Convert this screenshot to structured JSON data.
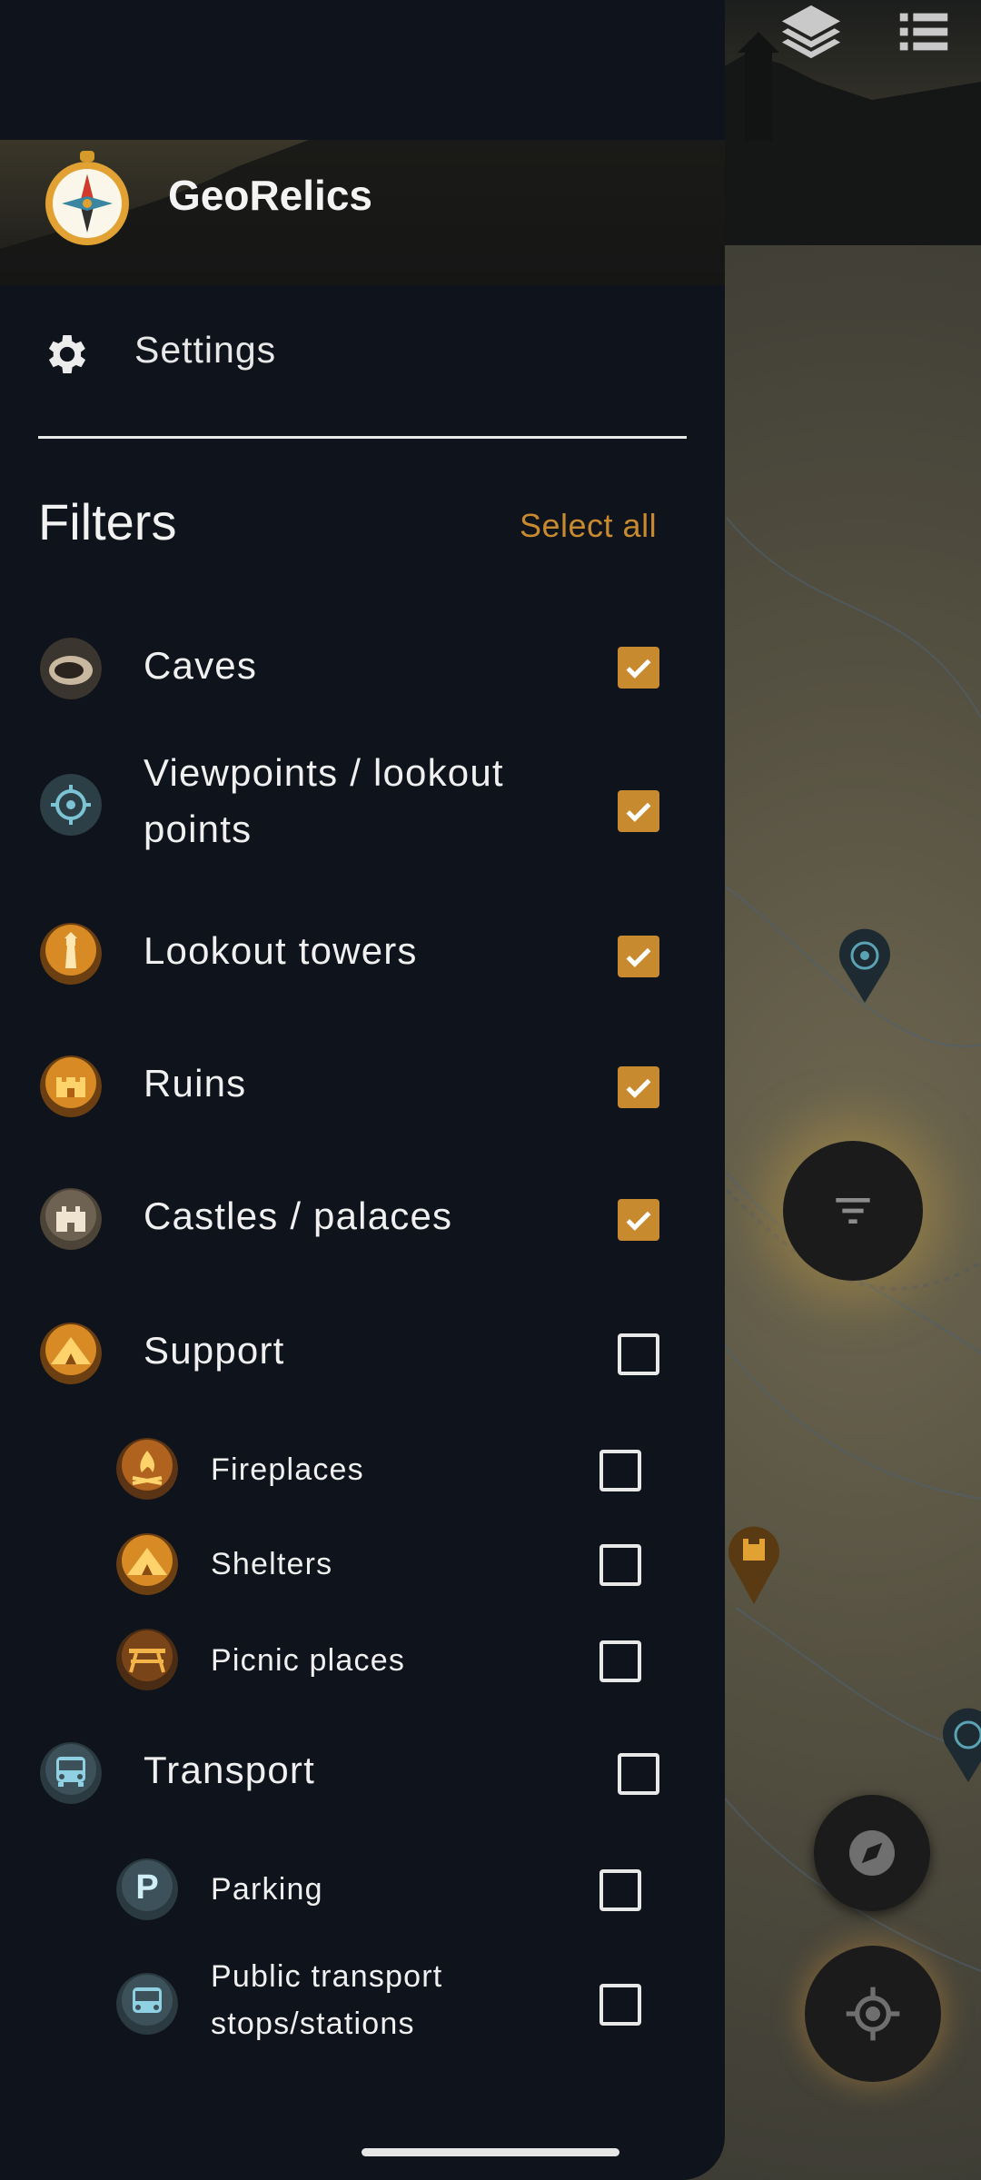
{
  "app": {
    "name": "GeoRelics"
  },
  "menu": {
    "settings_label": "Settings"
  },
  "filters": {
    "title": "Filters",
    "select_all_label": "Select all",
    "items": [
      {
        "label": "Caves",
        "checked": true,
        "icon": "cave-icon"
      },
      {
        "label": "Viewpoints / lookout points",
        "checked": true,
        "icon": "viewpoint-icon"
      },
      {
        "label": "Lookout towers",
        "checked": true,
        "icon": "lighthouse-icon"
      },
      {
        "label": "Ruins",
        "checked": true,
        "icon": "ruin-icon"
      },
      {
        "label": "Castles / palaces",
        "checked": true,
        "icon": "castle-icon"
      },
      {
        "label": "Support",
        "checked": false,
        "icon": "tent-icon",
        "children": [
          {
            "label": "Fireplaces",
            "checked": false,
            "icon": "campfire-icon"
          },
          {
            "label": "Shelters",
            "checked": false,
            "icon": "tent-icon"
          },
          {
            "label": "Picnic places",
            "checked": false,
            "icon": "picnic-table-icon"
          }
        ]
      },
      {
        "label": "Transport",
        "checked": false,
        "icon": "bus-icon",
        "children": [
          {
            "label": "Parking",
            "checked": false,
            "icon": "parking-icon"
          },
          {
            "label": "Public transport stops/stations",
            "checked": false,
            "icon": "bus-icon"
          }
        ]
      }
    ]
  },
  "colors": {
    "accent": "#c78a2e",
    "drawer_bg": "#0f131b",
    "text": "#f0f0f0"
  }
}
